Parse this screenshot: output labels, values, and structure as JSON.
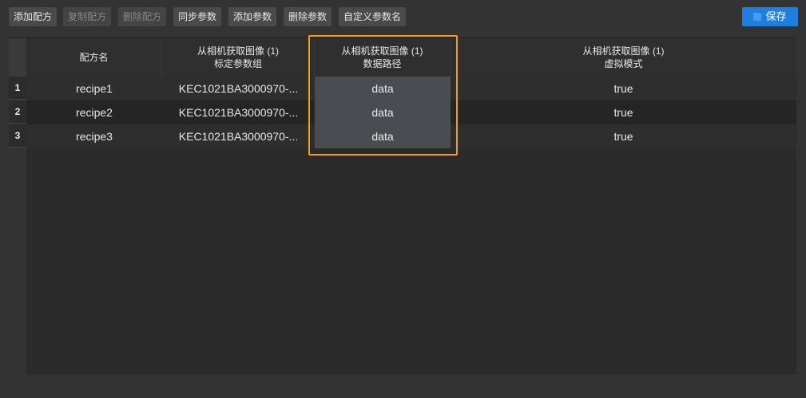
{
  "toolbar": {
    "buttons": [
      {
        "label": "添加配方",
        "enabled": true
      },
      {
        "label": "复制配方",
        "enabled": false
      },
      {
        "label": "删除配方",
        "enabled": false
      },
      {
        "label": "同步参数",
        "enabled": true
      },
      {
        "label": "添加参数",
        "enabled": true
      },
      {
        "label": "删除参数",
        "enabled": true
      },
      {
        "label": "自定义参数名",
        "enabled": true
      }
    ],
    "save_label": "保存"
  },
  "table": {
    "headers": [
      {
        "line1": "配方名",
        "line2": ""
      },
      {
        "line1": "从相机获取图像 (1)",
        "line2": "标定参数组"
      },
      {
        "line1": "从相机获取图像 (1)",
        "line2": "数据路径"
      },
      {
        "line1": "从相机获取图像 (1)",
        "line2": "虚拟模式"
      }
    ],
    "rows": [
      {
        "num": "1",
        "cells": [
          "recipe1",
          "KEC1021BA3000970-...",
          "data",
          "true"
        ]
      },
      {
        "num": "2",
        "cells": [
          "recipe2",
          "KEC1021BA3000970-...",
          "data",
          "true"
        ]
      },
      {
        "num": "3",
        "cells": [
          "recipe3",
          "KEC1021BA3000970-...",
          "data",
          "true"
        ]
      }
    ]
  },
  "colors": {
    "highlight_border": "#f39c1a",
    "save_button": "#1f7fe0"
  }
}
